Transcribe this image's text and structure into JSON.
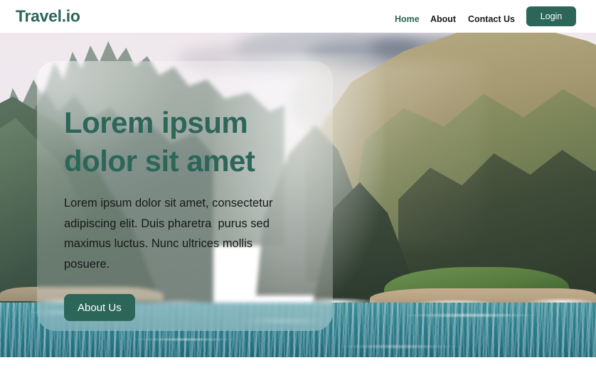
{
  "header": {
    "brand": "Travel.io",
    "nav": [
      {
        "label": "Home",
        "active": true
      },
      {
        "label": "About",
        "active": false
      },
      {
        "label": "Contact Us",
        "active": false
      }
    ],
    "login_label": "Login"
  },
  "hero": {
    "title": "Lorem ipsum dolor sit amet",
    "paragraph": "Lorem ipsum dolor sit amet, consectetur adipiscing elit. Duis pharetra  purus sed maximus luctus. Nunc ultrices mollis posuere.",
    "cta_label": "About Us",
    "background_alt": "coastal cliffs and ocean landscape"
  },
  "colors": {
    "brand_teal": "#2c6659",
    "nav_text": "#1a1a1a",
    "button_text": "#ffffff",
    "body_text": "#17191a",
    "page_background": "#ffffff",
    "ocean": "#2f7f8c",
    "glass_card": "rgba(255,255,255,0.28)"
  }
}
